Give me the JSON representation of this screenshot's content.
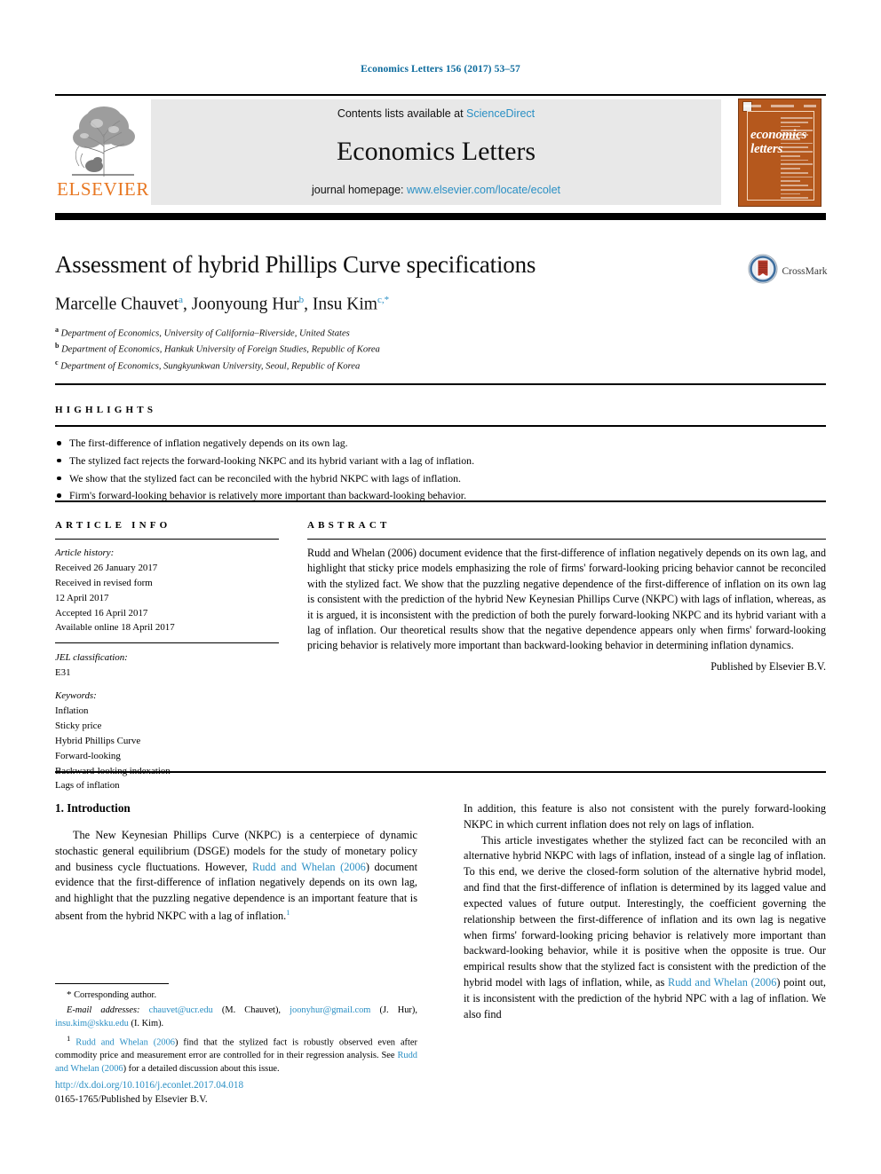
{
  "running_head": "Economics Letters 156 (2017) 53–57",
  "masthead": {
    "publisher_name": "ELSEVIER",
    "contents_prefix": "Contents lists available at ",
    "contents_link": "ScienceDirect",
    "journal_title": "Economics Letters",
    "homepage_prefix": "journal homepage: ",
    "homepage_url": "www.elsevier.com/locate/ecolet",
    "cover_title_line1": "economics",
    "cover_title_line2": "letters"
  },
  "crossmark": {
    "label": "CrossMark"
  },
  "title": "Assessment of hybrid Phillips Curve specifications",
  "authors": [
    {
      "name": "Marcelle Chauvet",
      "marker": "a"
    },
    {
      "name": "Joonyoung Hur",
      "marker": "b"
    },
    {
      "name": "Insu Kim",
      "marker": "c,*"
    }
  ],
  "affiliations": [
    {
      "marker": "a",
      "text": "Department of Economics, University of California–Riverside, United States"
    },
    {
      "marker": "b",
      "text": "Department of Economics, Hankuk University of Foreign Studies, Republic of Korea"
    },
    {
      "marker": "c",
      "text": "Department of Economics, Sungkyunkwan University, Seoul, Republic of Korea"
    }
  ],
  "highlights": {
    "heading": "HIGHLIGHTS",
    "items": [
      "The first-difference of inflation negatively depends on its own lag.",
      "The stylized fact rejects the forward-looking NKPC and its hybrid variant with a lag of inflation.",
      "We show that the stylized fact can be reconciled with the hybrid NKPC with lags of inflation.",
      "Firm's forward-looking behavior is relatively more important than backward-looking behavior."
    ]
  },
  "article_info": {
    "heading": "ARTICLE INFO",
    "history_label": "Article history:",
    "history": [
      "Received 26 January 2017",
      "Received in revised form",
      "12 April 2017",
      "Accepted 16 April 2017",
      "Available online 18 April 2017"
    ],
    "jel_label": "JEL classification:",
    "jel_codes": "E31",
    "keywords_label": "Keywords:",
    "keywords": [
      "Inflation",
      "Sticky price",
      "Hybrid Phillips Curve",
      "Forward-looking",
      "Backward-looking indexation",
      "Lags of inflation"
    ]
  },
  "abstract": {
    "heading": "ABSTRACT",
    "text": "Rudd and Whelan (2006) document evidence that the first-difference of inflation negatively depends on its own lag, and highlight that sticky price models emphasizing the role of firms' forward-looking pricing behavior cannot be reconciled with the stylized fact. We show that the puzzling negative dependence of the first-difference of inflation on its own lag is consistent with the prediction of the hybrid New Keynesian Phillips Curve (NKPC) with lags of inflation, whereas, as it is argued, it is inconsistent with the prediction of both the purely forward-looking NKPC and its hybrid variant with a lag of inflation. Our theoretical results show that the negative dependence appears only when firms' forward-looking pricing behavior is relatively more important than backward-looking behavior in determining inflation dynamics.",
    "publisher_statement": "Published by Elsevier B.V."
  },
  "body": {
    "section_heading": "1. Introduction",
    "left_para_1_a": "The New Keynesian Phillips Curve (NKPC) is a centerpiece of dynamic stochastic general equilibrium (DSGE) models for the study of monetary policy and business cycle fluctuations. However, ",
    "left_para_1_ref": "Rudd and Whelan",
    "left_para_1_year": "(2006",
    "left_para_1_b": ") document evidence that the first-difference of inflation negatively depends on its own lag, and highlight that the puzzling negative dependence is an important feature that is absent from the hybrid NKPC with a lag of inflation.",
    "left_para_1_fnmark": "1",
    "right_para_1": "In addition, this feature is also not consistent with the purely forward-looking NKPC in which current inflation does not rely on lags of inflation.",
    "right_para_2_a": "This article investigates whether the stylized fact can be reconciled with an alternative hybrid NKPC with lags of inflation, instead of a single lag of inflation. To this end, we derive the closed-form solution of the alternative hybrid model, and find that the first-difference of inflation is determined by its lagged value and expected values of future output. Interestingly, the coefficient governing the relationship between the first-difference of inflation and its own lag is negative when firms' forward-looking pricing behavior is relatively more important than backward-looking behavior, while it is positive when the opposite is true. Our empirical results show that the stylized fact is consistent with the prediction of the hybrid model with lags of inflation, while, as ",
    "right_para_2_ref": "Rudd and Whelan",
    "right_para_2_year": "(2006",
    "right_para_2_b": ") point out, it is inconsistent with the prediction of the hybrid NPC with a lag of inflation. We also find"
  },
  "footnotes": {
    "corresponding_marker": "*",
    "corresponding_text": "Corresponding author.",
    "email_label": "E-mail addresses:",
    "emails": [
      {
        "address": "chauvet@ucr.edu",
        "who": "(M. Chauvet),"
      },
      {
        "address": "joonyhur@gmail.com",
        "who": "(J. Hur),"
      },
      {
        "address": "insu.kim@skku.edu",
        "who": "(I. Kim)."
      }
    ],
    "note1_marker": "1",
    "note1_ref1": "Rudd and Whelan",
    "note1_year1": "(2006",
    "note1_a": ") find that the stylized fact is robustly observed even after commodity price and measurement error are controlled for in their regression analysis. See ",
    "note1_ref2": "Rudd and Whelan",
    "note1_year2": "(2006",
    "note1_b": ") for a detailed discussion about this issue."
  },
  "footer": {
    "doi": "http://dx.doi.org/10.1016/j.econlet.2017.04.018",
    "issn_line": "0165-1765/Published by Elsevier B.V."
  },
  "colors": {
    "link_blue": "#2a8fc4",
    "running_head_blue": "#0b6a9c",
    "elsevier_orange": "#e87722",
    "cover_brown": "#b5581d",
    "masthead_gray": "#e8e8e8"
  }
}
